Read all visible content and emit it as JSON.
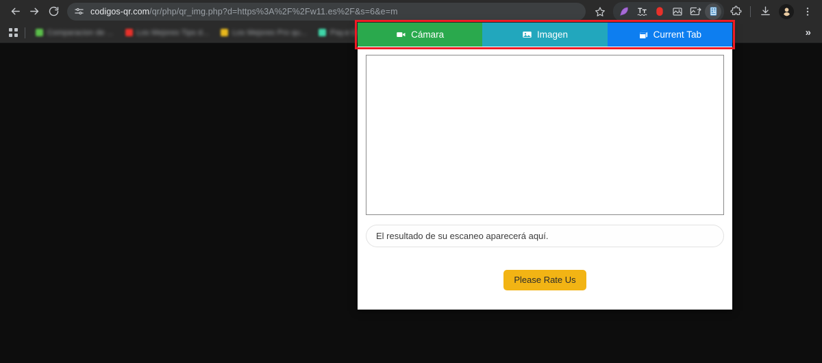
{
  "browser": {
    "nav": {
      "back_label": "Back",
      "back_icon": "arrow-left-icon",
      "forward_label": "Forward",
      "forward_icon": "arrow-right-icon",
      "reload_label": "Reload",
      "reload_icon": "reload-icon"
    },
    "omnibox": {
      "site_info_icon": "tune-site-settings-icon",
      "url_host": "codigos-qr.com",
      "url_path": "/qr/php/qr_img.php?d=https%3A%2F%2Fw11.es%2F&s=6&e=m",
      "bookmark_star_icon": "star-icon"
    },
    "extensions": [
      {
        "name": "feather-pen-extension-icon",
        "color": "#a66bd4",
        "active": false
      },
      {
        "name": "language-tool-extension-icon",
        "color": "#e8eaed",
        "active": false
      },
      {
        "name": "screen-recorder-extension-icon",
        "color": "#e8312a",
        "active": false
      },
      {
        "name": "image-capture-extension-icon",
        "color": "#c9ccd0",
        "active": false
      },
      {
        "name": "screenshot-export-extension-icon",
        "color": "#c9ccd0",
        "active": false
      },
      {
        "name": "qr-scanner-extension-icon",
        "color": "#5fa8e0",
        "active": true
      }
    ],
    "puzzle_icon": "puzzle-piece-extensions-icon",
    "download_icon": "download-icon",
    "avatar_icon": "profile-avatar-icon",
    "menu_icon": "three-dot-menu-icon",
    "bookmarks": {
      "apps_icon": "apps-grid-icon",
      "items": [
        {
          "label": "Comparacion de ...",
          "favicon_color": "#5bbf4a"
        },
        {
          "label": "Los Mejores Tips d...",
          "favicon_color": "#e8312a"
        },
        {
          "label": "Los Mejores Pro qu...",
          "favicon_color": "#e8b81c"
        },
        {
          "label": "Pay.e Dashboard",
          "favicon_color": "#3fd6a8"
        }
      ],
      "overflow_icon": "chevron-double-right-icon",
      "overflow_label": "»"
    }
  },
  "popup": {
    "tabs": [
      {
        "label": "Cámara",
        "icon": "video-camera-icon",
        "color": "#2aa94d",
        "active": true
      },
      {
        "label": "Imagen",
        "icon": "image-icon",
        "color": "#22a7bd",
        "active": false
      },
      {
        "label": "Current Tab",
        "icon": "browser-tab-copy-icon",
        "color": "#0d7ef0",
        "active": false
      }
    ],
    "scan_area_name": "qr-scan-preview-area",
    "result_placeholder": "El resultado de su escaneo aparecerá aquí.",
    "rate_button_label": "Please Rate Us",
    "rate_button_color": "#f2b414",
    "highlight_color": "#ee1c25"
  }
}
